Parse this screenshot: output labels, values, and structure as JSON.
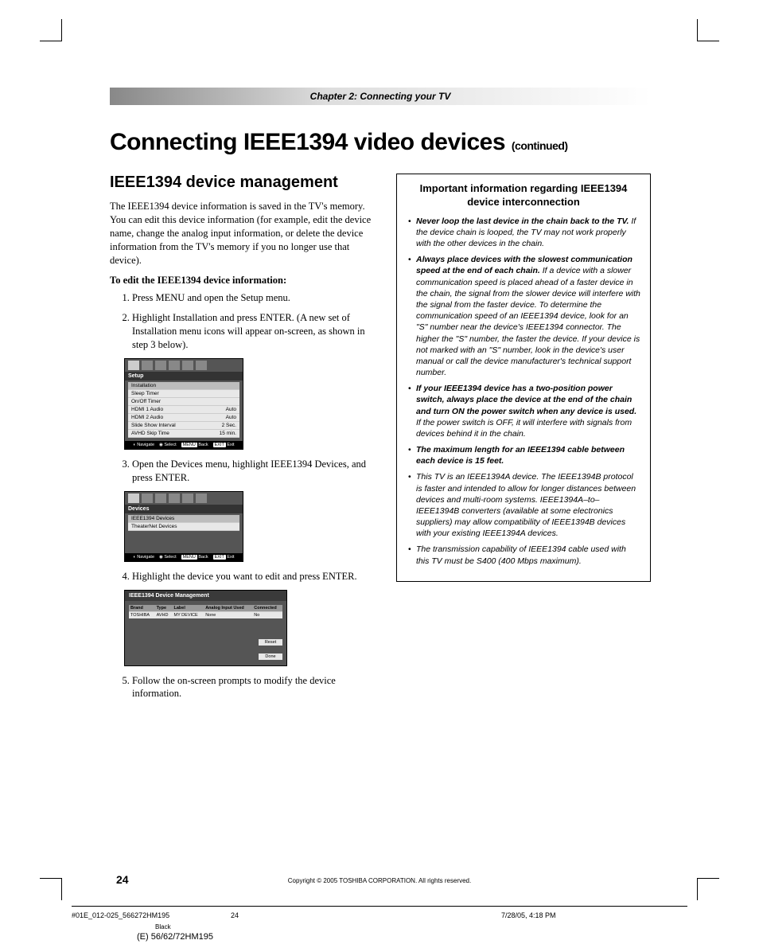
{
  "chapter": "Chapter 2: Connecting your TV",
  "title_main": "Connecting IEEE1394 video devices",
  "title_cont": "(continued)",
  "section_heading": "IEEE1394 device management",
  "intro": "The IEEE1394 device information is saved in the TV's memory. You can edit this device information (for example, edit the device name, change the analog input information, or delete the device information from the TV's memory if you no longer use that device).",
  "edit_lead": "To edit the IEEE1394 device information:",
  "steps": {
    "s1": "Press MENU and open the Setup menu.",
    "s2": "Highlight Installation and press ENTER. (A new set of Installation menu icons will appear on-screen, as shown in step 3 below).",
    "s3": "Open the Devices menu, highlight IEEE1394 Devices, and press ENTER.",
    "s4": "Highlight the device you want to edit and press ENTER.",
    "s5": "Follow the on-screen prompts to modify the device information."
  },
  "setup_menu": {
    "header": "Setup",
    "rows": [
      {
        "label": "Installation",
        "value": ""
      },
      {
        "label": "Sleep Timer",
        "value": ""
      },
      {
        "label": "On/Off Timer",
        "value": ""
      },
      {
        "label": "HDMI 1 Audio",
        "value": "Auto"
      },
      {
        "label": "HDMI 2 Audio",
        "value": "Auto"
      },
      {
        "label": "Slide Show Interval",
        "value": "2 Sec."
      },
      {
        "label": "AVHD Skip Time",
        "value": "15 min."
      }
    ],
    "footer": {
      "nav": "Navigate",
      "sel": "Select",
      "back": "Back",
      "exit": "Exit",
      "menu_lbl": "MENU",
      "exit_lbl": "EXIT"
    }
  },
  "devices_menu": {
    "header": "Devices",
    "rows": [
      {
        "label": "IEEE1394 Devices"
      },
      {
        "label": "TheaterNet Devices"
      }
    ]
  },
  "mgmt_table": {
    "title": "IEEE1394 Device Management",
    "headers": [
      "Brand",
      "Type",
      "Label",
      "Analog Input Used",
      "Connected"
    ],
    "row": [
      "TOSHIBA",
      "AVHD",
      "MY DEVICE",
      "None",
      "No"
    ],
    "btn_reset": "Reset",
    "btn_done": "Done"
  },
  "info_box": {
    "title": "Important information regarding IEEE1394 device interconnection",
    "items": [
      {
        "lead": "Never loop the last device in the chain back to the TV.",
        "rest": " If the device chain is looped, the TV may not work properly with the other devices in the chain."
      },
      {
        "lead": "Always place devices with the slowest communication speed at the end of each chain.",
        "rest": " If a device with a slower communication speed is placed ahead of a faster device in the chain, the signal from the slower device will interfere with the signal from the faster device. To determine the communication speed of an IEEE1394 device, look for an \"S\" number near the device's IEEE1394 connector. The higher the \"S\" number, the faster the device. If your device is not marked with an \"S\" number, look in the device's user manual or call the device manufacturer's technical support number."
      },
      {
        "lead": "If your IEEE1394 device has a two-position power switch, always place the device at the end of the chain and turn ON the power switch when any device is used.",
        "rest": " If the power switch is OFF, it will interfere with signals from devices behind it in the chain."
      },
      {
        "lead": "The maximum length for an IEEE1394 cable between each device is 15 feet.",
        "rest": ""
      },
      {
        "lead": "",
        "rest": "This TV is an IEEE1394A device. The IEEE1394B protocol is faster and intended to allow for longer distances between devices and multi-room systems. IEEE1394A–to–IEEE1394B converters (available at some electronics suppliers) may allow compatibility of IEEE1394B devices with your existing IEEE1394A devices."
      },
      {
        "lead": "",
        "rest": "The transmission capability of IEEE1394 cable used with this TV must be S400 (400 Mbps maximum)."
      }
    ]
  },
  "page_number": "24",
  "copyright": "Copyright © 2005 TOSHIBA CORPORATION. All rights reserved.",
  "footer": {
    "filename": "#01E_012-025_566272HM195",
    "pagenum": "24",
    "datetime": "7/28/05, 4:18 PM",
    "black": "Black",
    "model": "(E) 56/62/72HM195"
  }
}
